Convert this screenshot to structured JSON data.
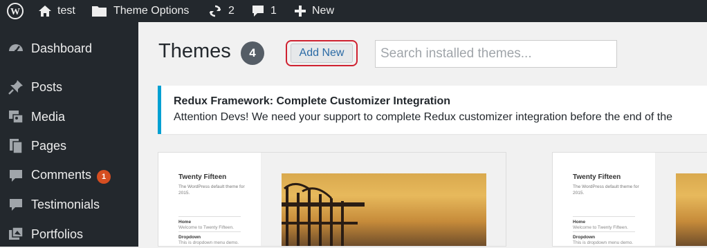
{
  "admin_bar": {
    "site_name": "test",
    "theme_options": "Theme Options",
    "updates_count": "2",
    "comments_count": "1",
    "new_label": "New",
    "icons": [
      "wordpress-icon",
      "home-icon",
      "folder-icon",
      "updates-icon",
      "comment-icon",
      "plus-icon"
    ]
  },
  "sidebar": {
    "items": [
      {
        "label": "Dashboard",
        "icon": "dashboard-icon"
      },
      {
        "label": "Posts",
        "icon": "pin-icon"
      },
      {
        "label": "Media",
        "icon": "media-icon"
      },
      {
        "label": "Pages",
        "icon": "pages-icon"
      },
      {
        "label": "Comments",
        "icon": "comment-icon",
        "badge": "1"
      },
      {
        "label": "Testimonials",
        "icon": "comment-icon"
      },
      {
        "label": "Portfolios",
        "icon": "portfolio-icon"
      }
    ]
  },
  "header": {
    "title": "Themes",
    "count": "4",
    "add_new_label": "Add New",
    "search_placeholder": "Search installed themes..."
  },
  "notice": {
    "heading": "Redux Framework: Complete Customizer Integration",
    "body": "Attention Devs! We need your support to complete Redux customizer integration before the end of the"
  },
  "themes": [
    {
      "name": "Twenty Fifteen",
      "description": "The WordPress default theme for 2015.",
      "nav": [
        {
          "title": "Home",
          "sub": "Welcome to Twenty Fifteen."
        },
        {
          "title": "Dropdown",
          "sub": "This is dropdown menu demo."
        }
      ]
    },
    {
      "name": "Twenty Fifteen",
      "description": "The WordPress default theme for 2015.",
      "nav": [
        {
          "title": "Home",
          "sub": "Welcome to Twenty Fifteen."
        },
        {
          "title": "Dropdown",
          "sub": "This is dropdown menu demo."
        }
      ]
    }
  ],
  "colors": {
    "admin_bar_bg": "#23282d",
    "accent_blue": "#00a0d2",
    "badge_orange": "#d54e21",
    "highlight_red": "#cf2130"
  }
}
